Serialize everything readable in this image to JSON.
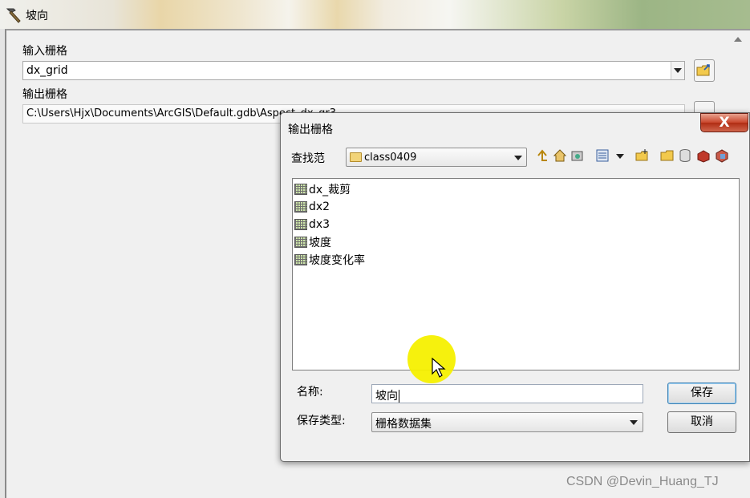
{
  "window": {
    "title": "坡向"
  },
  "tool": {
    "input_label": "输入栅格",
    "input_value": "dx_grid",
    "output_label": "输出栅格",
    "output_value": "C:\\Users\\Hjx\\Documents\\ArcGIS\\Default.gdb\\Aspect_dx_gr3"
  },
  "dialog": {
    "title": "输出栅格",
    "close_label": "X",
    "look_in_label": "查找范",
    "look_in_value": "class0409",
    "files": [
      {
        "name": "dx_裁剪"
      },
      {
        "name": "dx2"
      },
      {
        "name": "dx3"
      },
      {
        "name": "坡度"
      },
      {
        "name": "坡度变化率"
      }
    ],
    "name_label": "名称:",
    "name_value": "坡向",
    "type_label": "保存类型:",
    "type_value": "栅格数据集",
    "save_label": "保存",
    "cancel_label": "取消"
  },
  "watermark": "CSDN @Devin_Huang_TJ",
  "colors": {
    "cursor_highlight": "#f6f000",
    "close_button": "#c9452c"
  }
}
